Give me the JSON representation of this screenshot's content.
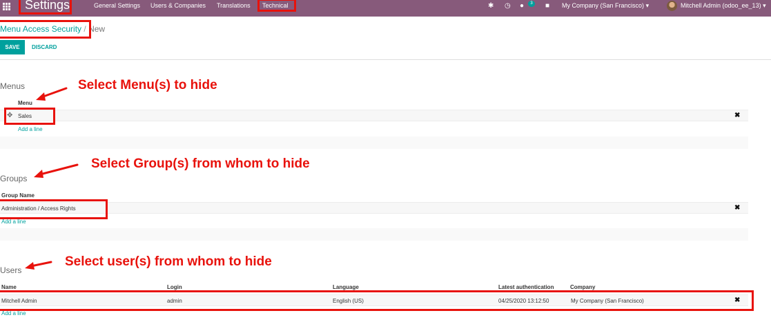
{
  "navbar": {
    "app_title": "Settings",
    "menu": [
      "General Settings",
      "Users & Companies",
      "Translations",
      "Technical"
    ],
    "chat_count": "3",
    "company": "My Company (San Francisco)",
    "user": "Mitchell Admin (odoo_ee_13)",
    "icons": [
      "apps-grid-icon",
      "bug-icon",
      "clock-icon",
      "chat-icon",
      "gift-icon",
      "caret-down-icon"
    ],
    "bg_color": "#875a7b"
  },
  "breadcrumb": {
    "parent": "Menu Access Security",
    "separator": "/",
    "current": "New"
  },
  "buttons": {
    "save": "SAVE",
    "discard": "DISCARD"
  },
  "menus": {
    "title": "Menus",
    "column": "Menu",
    "rows": [
      {
        "name": "Sales"
      }
    ],
    "add_line": "Add a line"
  },
  "groups": {
    "title": "Groups",
    "column": "Group Name",
    "rows": [
      {
        "name": "Administration / Access Rights"
      }
    ],
    "add_line": "Add a line"
  },
  "users": {
    "title": "Users",
    "columns": [
      "Name",
      "Login",
      "Language",
      "Latest authentication",
      "Company"
    ],
    "rows": [
      {
        "name": "Mitchell Admin",
        "login": "admin",
        "language": "English (US)",
        "latest_auth": "04/25/2020 13:12:50",
        "company": "My Company (San Francisco)"
      }
    ],
    "add_line": "Add a line"
  },
  "annotations": {
    "menus": "Select Menu(s) to hide",
    "groups": "Select Group(s) from whom to hide",
    "users": "Select user(s) from whom to hide",
    "color": "#e8120c"
  },
  "accent_color": "#00a09d"
}
